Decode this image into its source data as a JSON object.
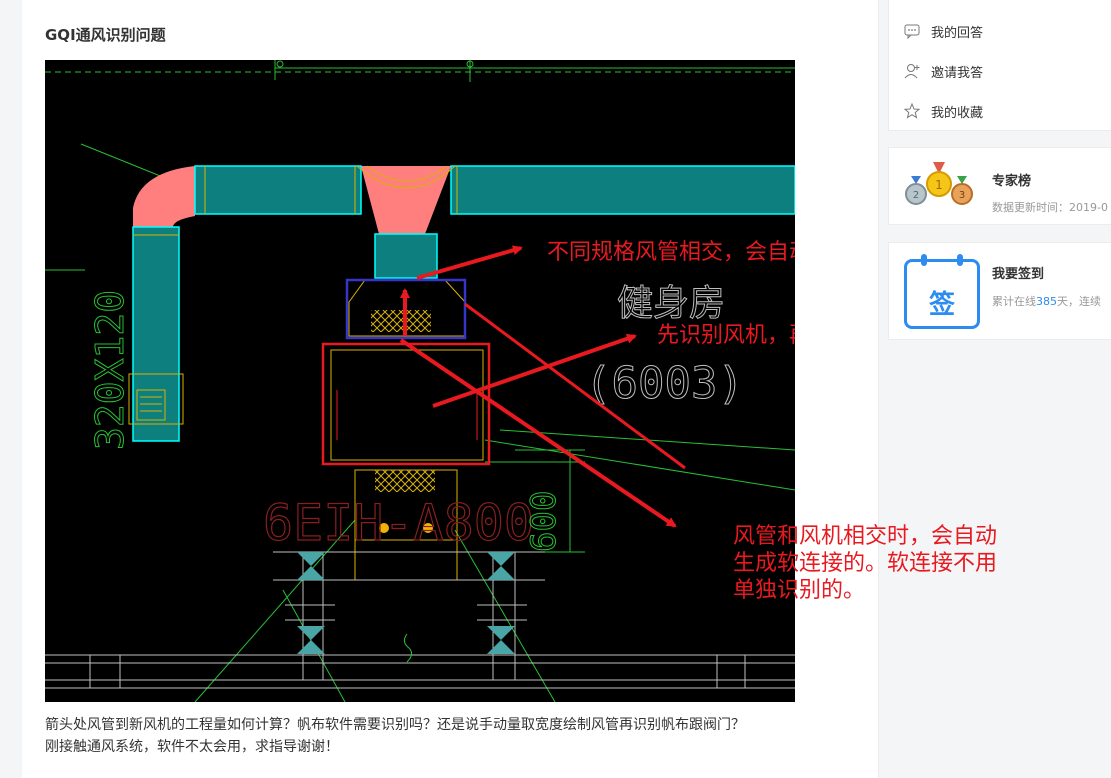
{
  "question": {
    "title": "GQI通风识别问题",
    "body_line1": "箭头处风管到新风机的工程量如何计算？帆布软件需要识别吗？还是说手动量取宽度绘制风管再识别帆布跟阀门？",
    "body_line2": "刚接触通风系统，软件不太会用，求指导谢谢！"
  },
  "drawing": {
    "dim_duct": "320X120",
    "room_name": "健身房",
    "room_no": "(6003)",
    "equip_code": "6EIH-A800",
    "dim_height": "600",
    "note1": "不同规格风管相交，会自动生成管件的。",
    "note2": "先识别风机，再识别风管",
    "note3_line1": "风管和风机相交时，会自动",
    "note3_line2": "生成软连接的。软连接不用",
    "note3_line3": "单独识别的。"
  },
  "sidebar": {
    "menu": [
      {
        "label": "我的回答",
        "icon": "comment-icon"
      },
      {
        "label": "邀请我答",
        "icon": "user-add-icon"
      },
      {
        "label": "我的收藏",
        "icon": "star-icon"
      }
    ],
    "experts": {
      "title": "专家榜",
      "subtitle": "数据更新时间：2019-0"
    },
    "checkin": {
      "title": "我要签到",
      "badge": "签",
      "prefix": "累计在线",
      "days": "385",
      "suffix": "天，连续"
    }
  },
  "colors": {
    "cad_bg": "#000000",
    "duct_fill": "#0e7f7f",
    "duct_edge": "#00ffff",
    "fitting": "#ff7f7f",
    "annotation_red": "#e8191f",
    "cad_green": "#27c034",
    "frame_blue": "#3535c8",
    "link_blue": "#2d8cf0"
  }
}
